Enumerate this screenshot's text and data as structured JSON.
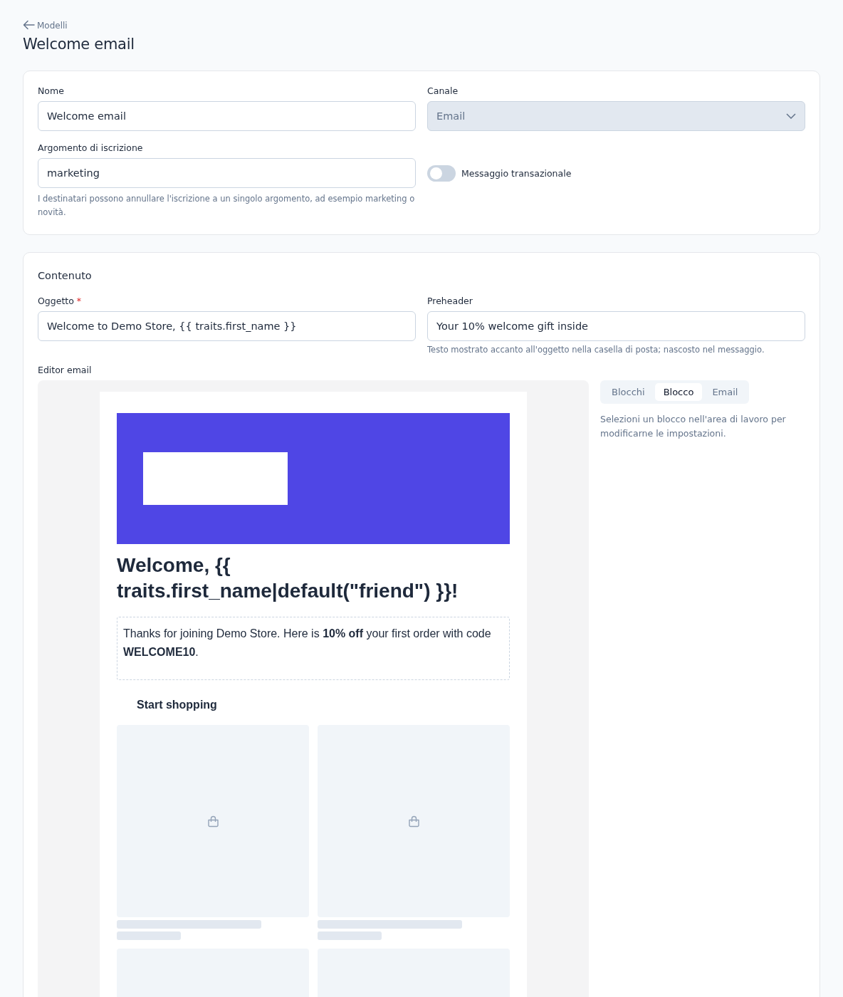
{
  "breadcrumb": {
    "label": "Modelli"
  },
  "title": "Welcome email",
  "settings": {
    "name": {
      "label": "Nome",
      "value": "Welcome email"
    },
    "channel": {
      "label": "Canale",
      "value": "Email",
      "disabled": true
    },
    "topic": {
      "label": "Argomento di iscrizione",
      "value": "marketing",
      "help": "I destinatari possono annullare l'iscrizione a un singolo argomento, ad esempio marketing o novità."
    },
    "transactional": {
      "label": "Messaggio transazionale",
      "on": false
    }
  },
  "content": {
    "title": "Contenuto",
    "subject": {
      "label": "Oggetto",
      "required_mark": "*",
      "value": "Welcome to Demo Store, {{ traits.first_name }}"
    },
    "preheader": {
      "label": "Preheader",
      "value": "Your 10% welcome gift inside",
      "help": "Testo mostrato accanto all'oggetto nella casella di posta; nascosto nel messaggio."
    },
    "editor_label": "Editor email",
    "email": {
      "heading": "Welcome, {{ traits.first_name|default(\"friend\") }}!",
      "body": "Thanks for joining Demo Store. Here is **10% off** your first order with code **WELCOME10**.",
      "cta": "Start shopping"
    },
    "tabs": [
      {
        "label": "Blocchi",
        "selected": false
      },
      {
        "label": "Blocco",
        "selected": true
      },
      {
        "label": "Email",
        "selected": false
      }
    ],
    "panel_hint": "Selezioni un blocco nell'area di lavoro per modificarne le impostazioni."
  }
}
